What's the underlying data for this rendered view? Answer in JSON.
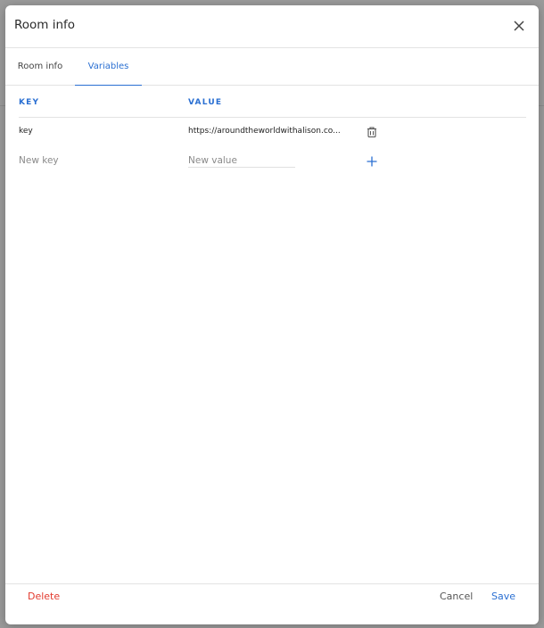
{
  "dialog": {
    "title": "Room info"
  },
  "tabs": [
    {
      "label": "Room info",
      "active": false
    },
    {
      "label": "Variables",
      "active": true
    }
  ],
  "table": {
    "headers": {
      "key": "KEY",
      "value": "VALUE"
    },
    "rows": [
      {
        "key": "key",
        "value": "https://aroundtheworldwithalison.co...",
        "action_icon": "trash-icon"
      }
    ],
    "new_row": {
      "key_placeholder": "New key",
      "value_placeholder": "New value",
      "action_icon": "plus-icon"
    }
  },
  "footer": {
    "delete_label": "Delete",
    "cancel_label": "Cancel",
    "save_label": "Save"
  },
  "colors": {
    "accent": "#2a6fd2",
    "danger": "#e23a2e"
  }
}
